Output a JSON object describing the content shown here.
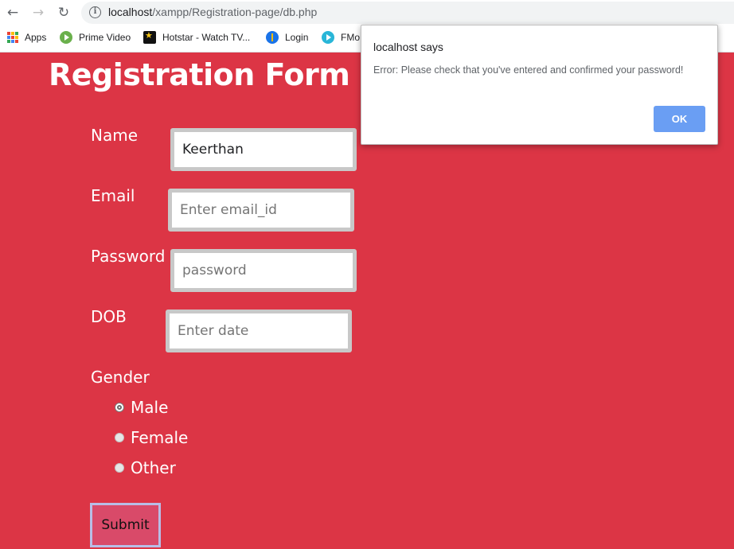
{
  "browser": {
    "url_host": "localhost",
    "url_path": "/xampp/Registration-page/db.php",
    "bookmarks": [
      {
        "label": "Apps",
        "icon": "apps-grid-icon"
      },
      {
        "label": "Prime Video",
        "icon": "prime-video-icon"
      },
      {
        "label": "Hotstar - Watch TV...",
        "icon": "hotstar-icon"
      },
      {
        "label": "Login",
        "icon": "login-icon"
      },
      {
        "label": "FMo",
        "icon": "fmovies-icon"
      }
    ]
  },
  "page": {
    "title": "Registration Form",
    "background_color": "#dc3545",
    "fields": {
      "name": {
        "label": "Name",
        "value": "Keerthan",
        "placeholder": ""
      },
      "email": {
        "label": "Email",
        "value": "",
        "placeholder": "Enter email_id"
      },
      "password": {
        "label": "Password",
        "value": "",
        "placeholder": "password"
      },
      "dob": {
        "label": "DOB",
        "value": "",
        "placeholder": "Enter date"
      }
    },
    "gender": {
      "label": "Gender",
      "options": [
        "Male",
        "Female",
        "Other"
      ],
      "selected": "Male"
    },
    "submit_label": "Submit"
  },
  "dialog": {
    "title": "localhost says",
    "message": "Error: Please check that you've entered and confirmed your password!",
    "ok_label": "OK",
    "ok_color": "#6a9ef3"
  }
}
